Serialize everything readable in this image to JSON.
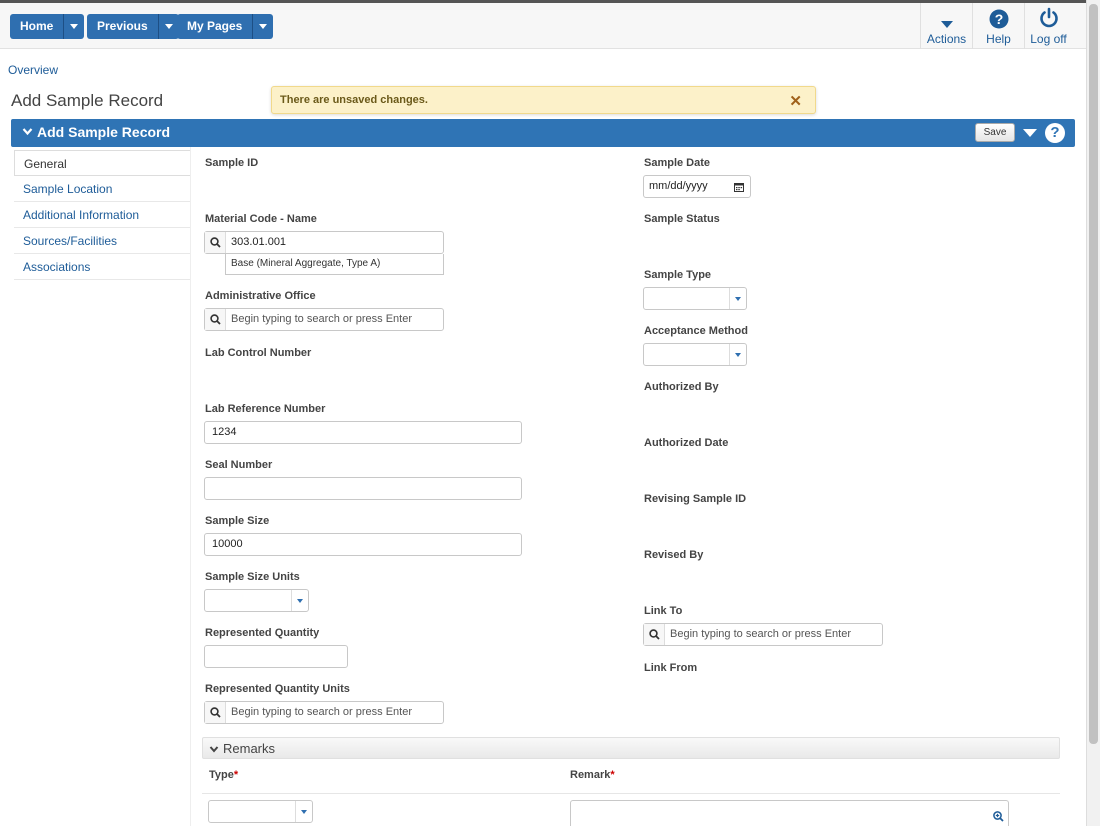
{
  "nav": {
    "home": "Home",
    "previous": "Previous",
    "my_pages": "My Pages"
  },
  "toolbar": {
    "actions": "Actions",
    "help": "Help",
    "logoff": "Log off"
  },
  "breadcrumb": "Overview",
  "page_title": "Add Sample Record",
  "toast": {
    "message": "There are unsaved changes.",
    "close": "✕"
  },
  "panel": {
    "title": "Add Sample Record",
    "save": "Save",
    "help": "?"
  },
  "sidenav": [
    {
      "label": "General"
    },
    {
      "label": "Sample Location"
    },
    {
      "label": "Additional Information"
    },
    {
      "label": "Sources/Facilities"
    },
    {
      "label": "Associations"
    }
  ],
  "left_fields": {
    "sample_id": "Sample ID",
    "material_code": "Material Code - Name",
    "material_code_value": "303.01.001",
    "material_code_desc": "Base (Mineral Aggregate, Type A)",
    "admin_office": "Administrative Office",
    "lab_control": "Lab Control Number",
    "lab_reference": "Lab Reference Number",
    "lab_reference_value": "1234",
    "seal_number": "Seal Number",
    "sample_size": "Sample Size",
    "sample_size_value": "10000",
    "sample_size_units": "Sample Size Units",
    "represented_qty": "Represented Quantity",
    "represented_qty_units": "Represented Quantity Units"
  },
  "right_fields": {
    "sample_date": "Sample Date",
    "sample_date_placeholder": "mm/dd/yyyy",
    "sample_status": "Sample Status",
    "sample_type": "Sample Type",
    "acceptance_method": "Acceptance Method",
    "authorized_by": "Authorized By",
    "authorized_date": "Authorized Date",
    "revising_sample_id": "Revising Sample ID",
    "revised_by": "Revised By",
    "link_to": "Link To",
    "link_from": "Link From"
  },
  "search_placeholder": "Begin typing to search or press Enter",
  "remarks": {
    "title": "Remarks",
    "type_col": "Type",
    "remark_col": "Remark",
    "required_mark": "*"
  },
  "colors": {
    "primary": "#2f74b5",
    "link": "#1e5c98",
    "toast_bg": "#fcf1c9"
  }
}
